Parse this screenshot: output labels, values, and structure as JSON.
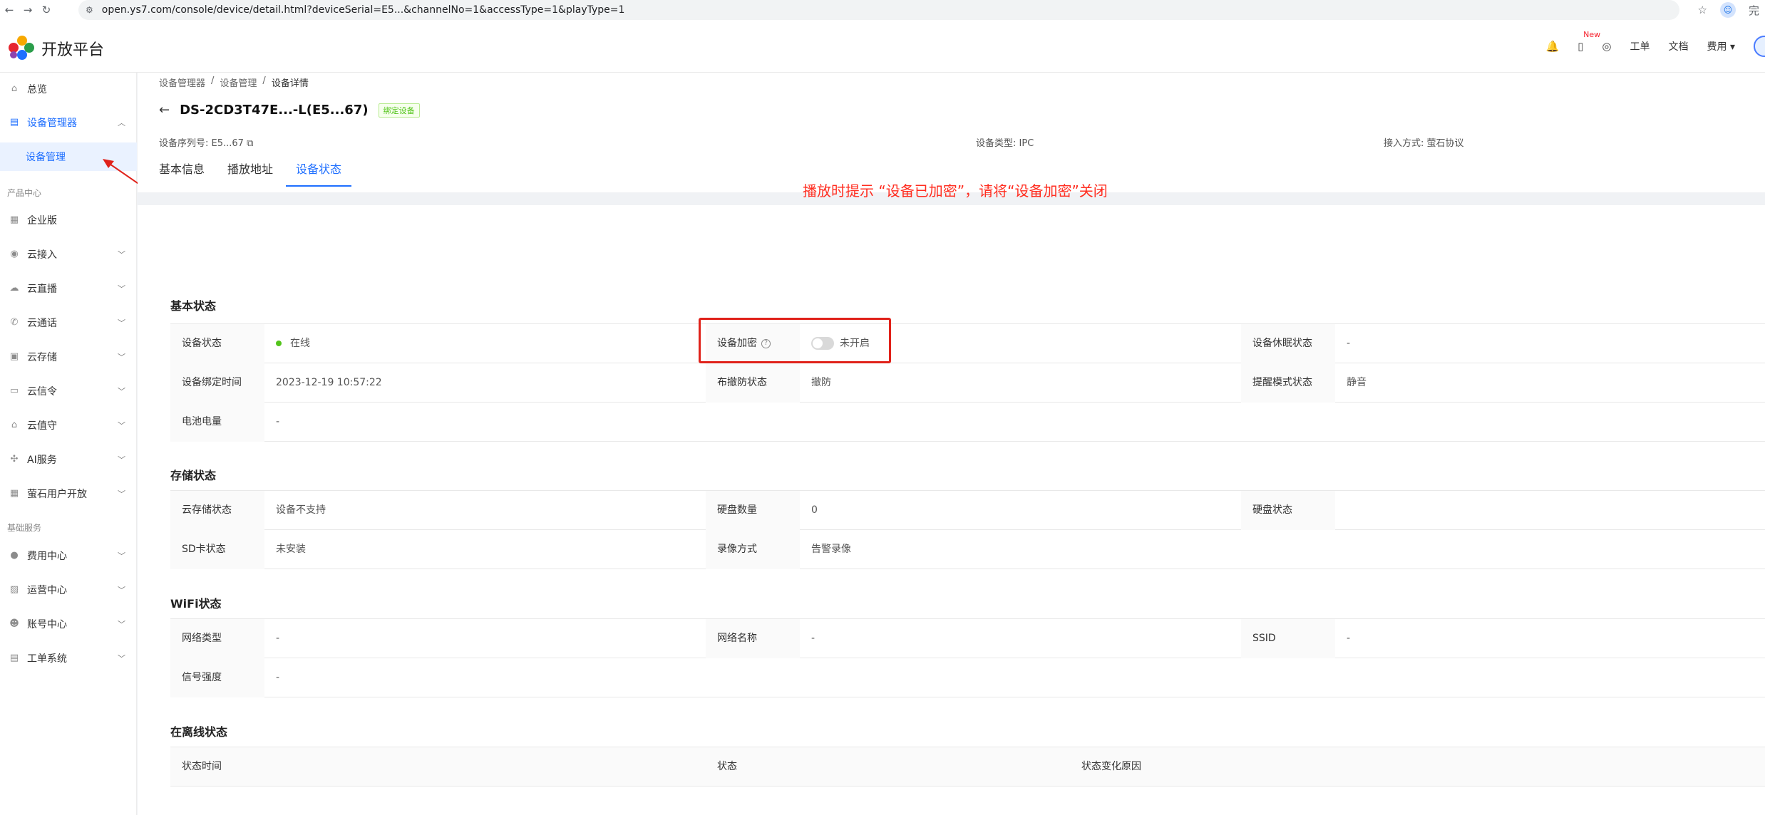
{
  "browser": {
    "back": "←",
    "forward": "→",
    "reload": "↻",
    "tune_icon": "⚙",
    "url": "open.ys7.com/console/device/detail.html?deviceSerial=E5...&channelNo=1&accessType=1&playType=1",
    "star": "☆",
    "profile": "☺",
    "profile_label": "完"
  },
  "header": {
    "logo_text": "开放平台",
    "new_badge": "New",
    "work_order": "工单",
    "docs": "文档",
    "fees": "费用",
    "bell_icon": "🔔",
    "phone_icon": "▯",
    "compass_icon": "◎",
    "caret": "▾"
  },
  "sidebar": {
    "overview": "总览",
    "device_manager": "设备管理器",
    "device_manage": "设备管理",
    "group_product": "产品中心",
    "enterprise": "企业版",
    "cloud_access": "云接入",
    "cloud_live": "云直播",
    "cloud_call": "云通话",
    "cloud_storage": "云存储",
    "cloud_signal": "云信令",
    "cloud_guard": "云值守",
    "ai_service": "AI服务",
    "ezviz_user": "萤石用户开放",
    "group_basic": "基础服务",
    "fee_center": "费用中心",
    "ops_center": "运营中心",
    "account_center": "账号中心",
    "ticket_system": "工单系统"
  },
  "breadcrumb": {
    "item1": "设备管理器",
    "item2": "设备管理",
    "item3": "设备详情",
    "sep": "/"
  },
  "device": {
    "back_icon": "←",
    "title": "DS-2CD3T47E...-L(E5...67)",
    "bound_tag": "绑定设备",
    "serial_label": "设备序列号:",
    "serial_value": "E5...67",
    "copy_icon": "⧉",
    "type_label": "设备类型:",
    "type_value": "IPC",
    "access_label": "接入方式:",
    "access_value": "萤石协议"
  },
  "tabs": {
    "basic": "基本信息",
    "play": "播放地址",
    "status": "设备状态"
  },
  "annotation": {
    "text": "播放时提示 “设备已加密”，请将“设备加密”关闭",
    "color": "#ff2d20"
  },
  "basic_status": {
    "title": "基本状态",
    "device_status_label": "设备状态",
    "device_status_value": "在线",
    "encrypt_label": "设备加密",
    "encrypt_help": "?",
    "encrypt_value": "未开启",
    "sleep_label": "设备休眠状态",
    "sleep_value": "-",
    "bind_time_label": "设备绑定时间",
    "bind_time_value": "2023-12-19 10:57:22",
    "arming_label": "布撤防状态",
    "arming_value": "撤防",
    "remind_label": "提醒模式状态",
    "remind_value": "静音",
    "battery_label": "电池电量",
    "battery_value": "-"
  },
  "storage_status": {
    "title": "存储状态",
    "cloud_label": "云存储状态",
    "cloud_value": "设备不支持",
    "disk_count_label": "硬盘数量",
    "disk_count_value": "0",
    "disk_status_label": "硬盘状态",
    "disk_status_value": "",
    "sd_label": "SD卡状态",
    "sd_value": "未安装",
    "record_label": "录像方式",
    "record_value": "告警录像"
  },
  "wifi_status": {
    "title": "WiFi状态",
    "net_type_label": "网络类型",
    "net_type_value": "-",
    "net_name_label": "网络名称",
    "net_name_value": "-",
    "ssid_label": "SSID",
    "ssid_value": "-",
    "signal_label": "信号强度",
    "signal_value": "-"
  },
  "online_status": {
    "title": "在离线状态",
    "col_time": "状态时间",
    "col_status": "状态",
    "col_reason": "状态变化原因"
  }
}
